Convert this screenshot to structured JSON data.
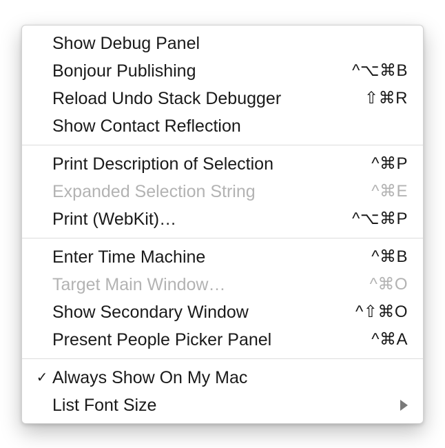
{
  "menu": {
    "groups": [
      {
        "items": [
          {
            "label": "Show Debug Panel",
            "shortcut": "",
            "disabled": false,
            "checked": false,
            "submenu": false
          },
          {
            "label": "Bonjour Publishing",
            "shortcut": "^⌥⌘B",
            "disabled": false,
            "checked": false,
            "submenu": false
          },
          {
            "label": "Reload Undo Stack Debugger",
            "shortcut": "⇧⌘R",
            "disabled": false,
            "checked": false,
            "submenu": false
          },
          {
            "label": "Show Contact Reflection",
            "shortcut": "",
            "disabled": false,
            "checked": false,
            "submenu": false
          }
        ]
      },
      {
        "items": [
          {
            "label": "Print Description of Selection",
            "shortcut": "^⌘P",
            "disabled": false,
            "checked": false,
            "submenu": false
          },
          {
            "label": "Expanded Selection String",
            "shortcut": "^⌘E",
            "disabled": true,
            "checked": false,
            "submenu": false
          },
          {
            "label": "Print (WebKit)…",
            "shortcut": "^⌥⌘P",
            "disabled": false,
            "checked": false,
            "submenu": false
          }
        ]
      },
      {
        "items": [
          {
            "label": "Enter Time Machine",
            "shortcut": "^⌘B",
            "disabled": false,
            "checked": false,
            "submenu": false
          },
          {
            "label": "Target Main Window…",
            "shortcut": "^⌘O",
            "disabled": true,
            "checked": false,
            "submenu": false
          },
          {
            "label": "Show Secondary Window",
            "shortcut": "^⇧⌘O",
            "disabled": false,
            "checked": false,
            "submenu": false
          },
          {
            "label": "Present People Picker Panel",
            "shortcut": "^⌘A",
            "disabled": false,
            "checked": false,
            "submenu": false
          }
        ]
      },
      {
        "items": [
          {
            "label": "Always Show On My Mac",
            "shortcut": "",
            "disabled": false,
            "checked": true,
            "submenu": false
          },
          {
            "label": "List Font Size",
            "shortcut": "",
            "disabled": false,
            "checked": false,
            "submenu": true
          }
        ]
      }
    ]
  }
}
